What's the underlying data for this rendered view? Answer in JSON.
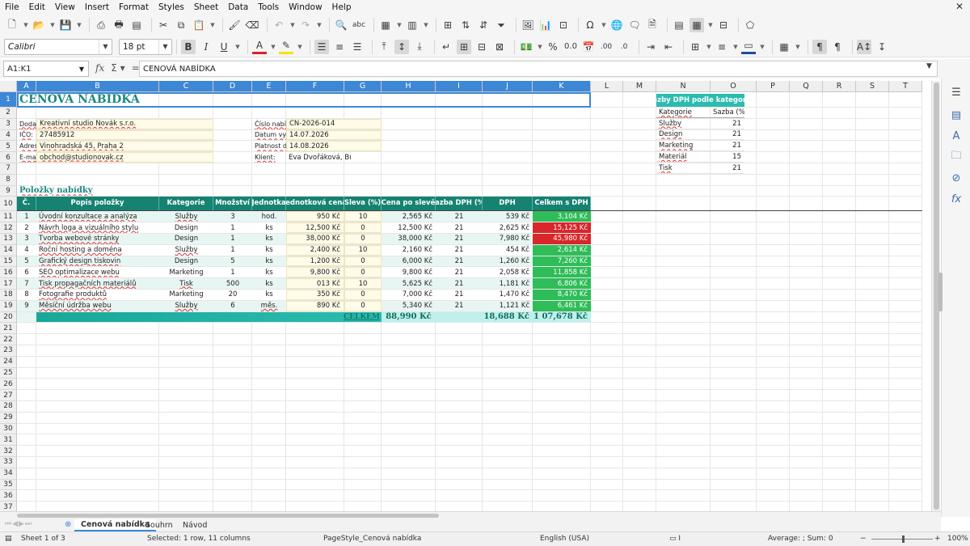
{
  "menu": [
    "File",
    "Edit",
    "View",
    "Insert",
    "Format",
    "Styles",
    "Sheet",
    "Data",
    "Tools",
    "Window",
    "Help"
  ],
  "font": {
    "name": "Calibri",
    "size": "18 pt"
  },
  "namebox": "A1:K1",
  "formula": "CENOVÁ NABÍDKA",
  "columns": [
    "A",
    "B",
    "C",
    "D",
    "E",
    "F",
    "G",
    "H",
    "I",
    "J",
    "K",
    "L",
    "M",
    "N",
    "O",
    "P",
    "Q",
    "R",
    "S",
    "T"
  ],
  "rows": [
    "1",
    "2",
    "3",
    "4",
    "5",
    "6",
    "7",
    "8",
    "9",
    "10",
    "11",
    "12",
    "13",
    "14",
    "15",
    "16",
    "17",
    "18",
    "19",
    "20",
    "21",
    "22",
    "23",
    "24",
    "25",
    "26",
    "27",
    "28",
    "29",
    "30",
    "31",
    "32",
    "33",
    "34",
    "35",
    "36",
    "37"
  ],
  "sheet": {
    "title": "CENOVÁ NABÍDKA",
    "supplier": [
      {
        "label": "Dodavatel:",
        "value": "Kreativní studio Novák s.r.o."
      },
      {
        "label": "IČO:",
        "value": "27485912"
      },
      {
        "label": "Adresa:",
        "value": "Vinohradská 45, Praha 2"
      },
      {
        "label": "E-mail:",
        "value": "obchod@studionovak.cz"
      }
    ],
    "offer": [
      {
        "label": "Číslo nabídky:",
        "value": "CN-2026-014"
      },
      {
        "label": "Datum vystavení:",
        "value": "14.07.2026"
      },
      {
        "label": "Platnost do:",
        "value": "14.08.2026"
      },
      {
        "label": "Klient:",
        "value": "Eva Dvořáková, Brno"
      }
    ],
    "items_title": "Položky nabídky",
    "headers": [
      "Č.",
      "Popis položky",
      "Kategorie",
      "Množství",
      "Jednotka",
      "Jednotková cena",
      "Sleva (%)",
      "Cena po slevě",
      "Sazba DPH (%)",
      "DPH",
      "Celkem s DPH"
    ],
    "items": [
      {
        "n": "1",
        "desc": "Úvodní konzultace a analýza",
        "cat": "Služby",
        "qty": "3",
        "unit": "hod.",
        "price": "950 Kč",
        "disc": "10",
        "after": "2,565 Kč",
        "vat": "21",
        "dph": "539 Kč",
        "total": "3,104 Kč",
        "flag": "green"
      },
      {
        "n": "2",
        "desc": "Návrh loga a vizuálního stylu",
        "cat": "Design",
        "qty": "1",
        "unit": "ks",
        "price": "12,500 Kč",
        "disc": "0",
        "after": "12,500 Kč",
        "vat": "21",
        "dph": "2,625 Kč",
        "total": "15,125 Kč",
        "flag": "red"
      },
      {
        "n": "3",
        "desc": "Tvorba webové stránky",
        "cat": "Design",
        "qty": "1",
        "unit": "ks",
        "price": "38,000 Kč",
        "disc": "0",
        "after": "38,000 Kč",
        "vat": "21",
        "dph": "7,980 Kč",
        "total": "45,980 Kč",
        "flag": "red"
      },
      {
        "n": "4",
        "desc": "Roční hosting a doména",
        "cat": "Služby",
        "qty": "1",
        "unit": "ks",
        "price": "2,400 Kč",
        "disc": "10",
        "after": "2,160 Kč",
        "vat": "21",
        "dph": "454 Kč",
        "total": "2,614 Kč",
        "flag": "green"
      },
      {
        "n": "5",
        "desc": "Grafický design tiskovin",
        "cat": "Design",
        "qty": "5",
        "unit": "ks",
        "price": "1,200 Kč",
        "disc": "0",
        "after": "6,000 Kč",
        "vat": "21",
        "dph": "1,260 Kč",
        "total": "7,260 Kč",
        "flag": "green"
      },
      {
        "n": "6",
        "desc": "SEO optimalizace webu",
        "cat": "Marketing",
        "qty": "1",
        "unit": "ks",
        "price": "9,800 Kč",
        "disc": "0",
        "after": "9,800 Kč",
        "vat": "21",
        "dph": "2,058 Kč",
        "total": "11,858 Kč",
        "flag": "green"
      },
      {
        "n": "7",
        "desc": "Tisk propagačních materiálů",
        "cat": "Tisk",
        "qty": "500",
        "unit": "ks",
        "price": "013 Kč",
        "disc": "10",
        "after": "5,625 Kč",
        "vat": "21",
        "dph": "1,181 Kč",
        "total": "6,806 Kč",
        "flag": "green"
      },
      {
        "n": "8",
        "desc": "Fotografie produktů",
        "cat": "Marketing",
        "qty": "20",
        "unit": "ks",
        "price": "350 Kč",
        "disc": "0",
        "after": "7,000 Kč",
        "vat": "21",
        "dph": "1,470 Kč",
        "total": "8,470 Kč",
        "flag": "green"
      },
      {
        "n": "9",
        "desc": "Měsíční údržba webu",
        "cat": "Služby",
        "qty": "6",
        "unit": "měs.",
        "price": "890 Kč",
        "disc": "0",
        "after": "5,340 Kč",
        "vat": "21",
        "dph": "1,121 Kč",
        "total": "6,461 Kč",
        "flag": "green"
      }
    ],
    "total": {
      "label": "CELKEM",
      "after": "88,990 Kč",
      "dph": "18,688 Kč",
      "total": "1 07,678 Kč"
    },
    "vat_table": {
      "title": "Sazby DPH podle kategorie",
      "headers": [
        "Kategorie",
        "Sazba (%)"
      ],
      "rows": [
        [
          "Služby",
          "21"
        ],
        [
          "Design",
          "21"
        ],
        [
          "Marketing",
          "21"
        ],
        [
          "Materiál",
          "15"
        ],
        [
          "Tisk",
          "21"
        ]
      ]
    }
  },
  "tabs": [
    "Cenová nabídka",
    "Souhrn",
    "Návod"
  ],
  "status": {
    "sheet": "Sheet 1 of 3",
    "selection": "Selected: 1 row, 11 columns",
    "pagestyle": "PageStyle_Cenová nabídka",
    "language": "English (USA)",
    "sum": "Average: ; Sum: 0",
    "zoom": "100%"
  },
  "colors": {
    "accent": "#168272",
    "teal": "#2bbcb0",
    "green": "#2ebd58",
    "red": "#d8262a",
    "select": "#3c87d6"
  }
}
